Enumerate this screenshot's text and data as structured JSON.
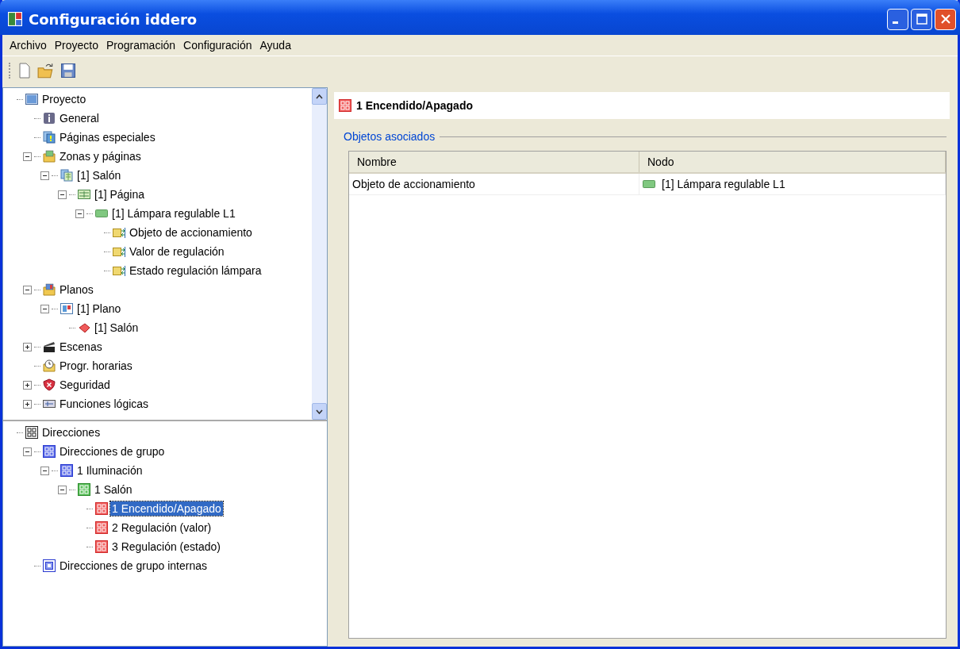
{
  "window": {
    "title": "Configuración iddero"
  },
  "menu": [
    "Archivo",
    "Proyecto",
    "Programación",
    "Configuración",
    "Ayuda"
  ],
  "project_tree": {
    "items": [
      {
        "label": "Proyecto",
        "kind": "project",
        "selected": false,
        "children": [
          {
            "label": "General",
            "kind": "info",
            "selected": false
          },
          {
            "label": "Páginas especiales",
            "kind": "special",
            "selected": false
          },
          {
            "label": "Zonas y páginas",
            "kind": "folder-grid",
            "expanded": true,
            "selected": false,
            "children": [
              {
                "label": "[1] Salón",
                "kind": "pages",
                "expanded": true,
                "selected": false,
                "children": [
                  {
                    "label": "[1] Página",
                    "kind": "grid",
                    "expanded": true,
                    "selected": false,
                    "children": [
                      {
                        "label": "[1] Lámpara regulable L1",
                        "kind": "lamp",
                        "expanded": true,
                        "selected": false,
                        "children": [
                          {
                            "label": "Objeto de accionamiento",
                            "kind": "object",
                            "selected": false
                          },
                          {
                            "label": "Valor de regulación",
                            "kind": "object",
                            "selected": false
                          },
                          {
                            "label": "Estado regulación lámpara",
                            "kind": "object",
                            "selected": false
                          }
                        ]
                      }
                    ]
                  }
                ]
              }
            ]
          },
          {
            "label": "Planos",
            "kind": "folder-plan",
            "expanded": true,
            "selected": false,
            "children": [
              {
                "label": "[1] Plano",
                "kind": "plan",
                "expanded": true,
                "selected": false,
                "children": [
                  {
                    "label": "[1] Salón",
                    "kind": "diamond",
                    "selected": false
                  }
                ]
              }
            ]
          },
          {
            "label": "Escenas",
            "kind": "clapper",
            "expanded": false,
            "selected": false
          },
          {
            "label": "Progr. horarias",
            "kind": "clock",
            "selected": false
          },
          {
            "label": "Seguridad",
            "kind": "shield",
            "expanded": false,
            "selected": false
          },
          {
            "label": "Funciones lógicas",
            "kind": "logic",
            "expanded": false,
            "selected": false
          }
        ]
      }
    ]
  },
  "address_tree": {
    "items": [
      {
        "label": "Direcciones",
        "kind": "addr-black",
        "selected": false,
        "children": [
          {
            "label": "Direcciones de grupo",
            "kind": "addr-blue",
            "expanded": true,
            "selected": false,
            "children": [
              {
                "label": "1 Iluminación",
                "kind": "addr-blue",
                "expanded": true,
                "selected": false,
                "children": [
                  {
                    "label": "1 Salón",
                    "kind": "addr-green",
                    "expanded": true,
                    "selected": false,
                    "children": [
                      {
                        "label": "1 Encendido/Apagado",
                        "kind": "addr-red",
                        "selected": true
                      },
                      {
                        "label": "2 Regulación (valor)",
                        "kind": "addr-red",
                        "selected": false
                      },
                      {
                        "label": "3 Regulación (estado)",
                        "kind": "addr-red",
                        "selected": false
                      }
                    ]
                  }
                ]
              }
            ]
          },
          {
            "label": "Direcciones de grupo internas",
            "kind": "addr-internal",
            "selected": false
          }
        ]
      }
    ]
  },
  "detail": {
    "title": "1 Encendido/Apagado",
    "kind": "addr-red",
    "group_title": "Objetos asociados",
    "table": {
      "columns": [
        "Nombre",
        "Nodo"
      ],
      "rows": [
        {
          "cells": [
            "Objeto de accionamiento",
            "[1] Lámpara regulable L1"
          ],
          "kind": "lamp"
        }
      ]
    }
  }
}
